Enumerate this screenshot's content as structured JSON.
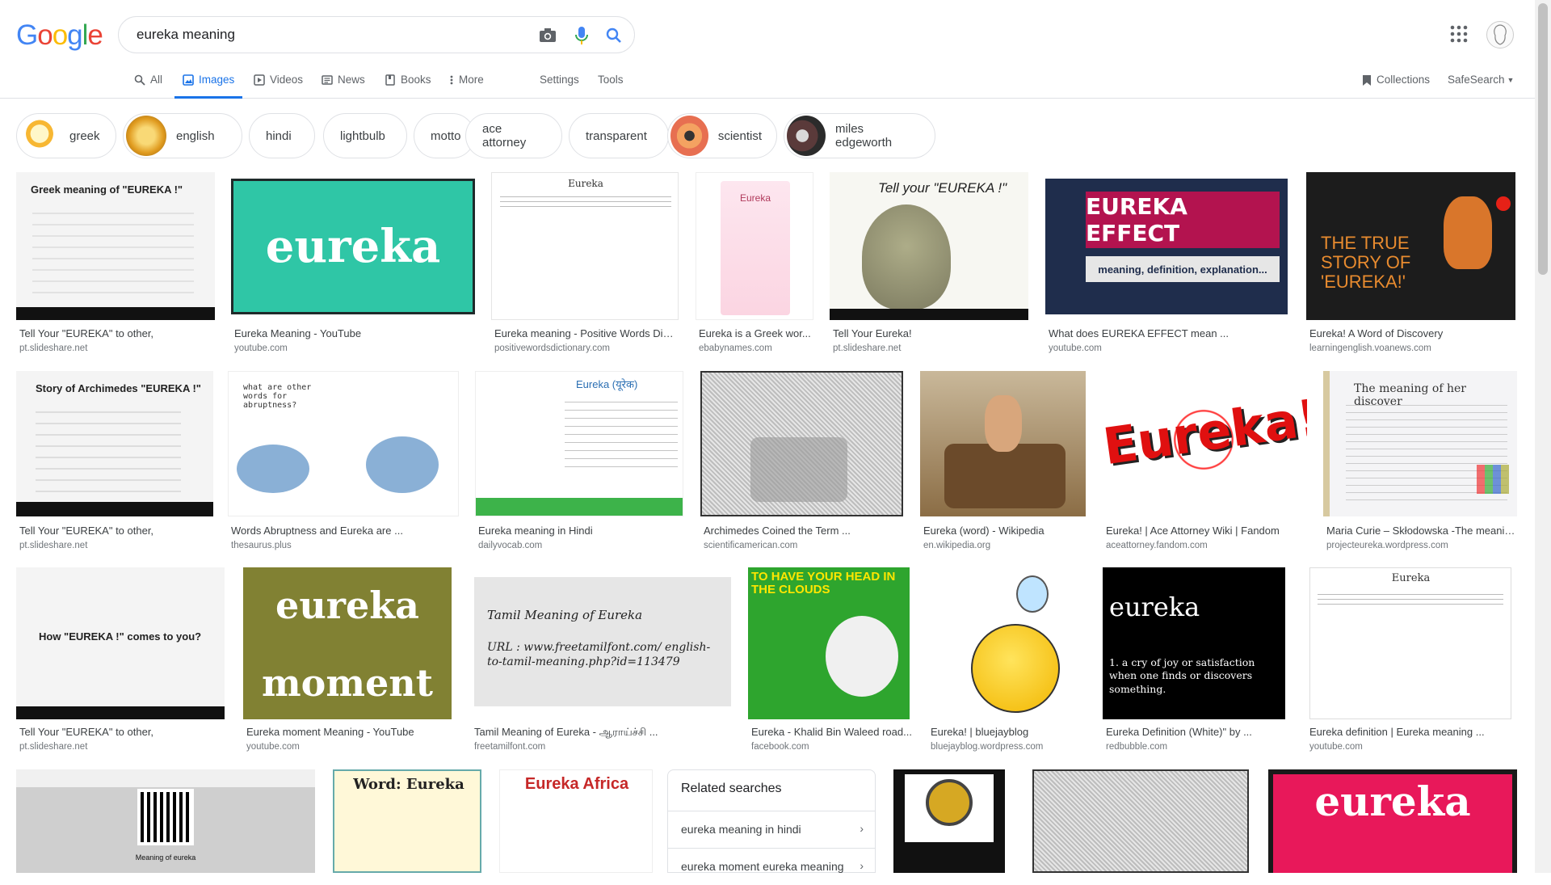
{
  "logo": {
    "letters": [
      "G",
      "o",
      "o",
      "g",
      "l",
      "e"
    ],
    "colors": [
      "#4285F4",
      "#EA4335",
      "#FBBC05",
      "#4285F4",
      "#34A853",
      "#EA4335"
    ]
  },
  "search": {
    "query": "eureka meaning",
    "placeholder": ""
  },
  "nav": {
    "tabs": [
      {
        "label": "All",
        "icon": "search-icon"
      },
      {
        "label": "Images",
        "icon": "image-icon",
        "active": true
      },
      {
        "label": "Videos",
        "icon": "play-icon"
      },
      {
        "label": "News",
        "icon": "news-icon"
      },
      {
        "label": "Books",
        "icon": "book-icon"
      },
      {
        "label": "More",
        "icon": "more-vert-icon"
      }
    ],
    "settings": "Settings",
    "tools": "Tools",
    "collections": "Collections",
    "safesearch": "SafeSearch"
  },
  "chips": [
    "greek",
    "english",
    "hindi",
    "lightbulb",
    "motto",
    "ace attorney",
    "transparent",
    "scientist",
    "miles edgeworth"
  ],
  "results": {
    "row1": [
      {
        "title": "Tell Your \"EUREKA\" to other,",
        "domain": "pt.slideshare.net",
        "caption": "Greek meaning of \"EUREKA !\""
      },
      {
        "title": "Eureka Meaning - YouTube",
        "domain": "youtube.com",
        "caption": "eureka"
      },
      {
        "title": "Eureka meaning - Positive Words Dicti...",
        "domain": "positivewordsdictionary.com",
        "caption": "Eureka"
      },
      {
        "title": "Eureka is a Greek wor...",
        "domain": "ebabynames.com",
        "caption": "Eureka"
      },
      {
        "title": "Tell Your Eureka!",
        "domain": "pt.slideshare.net",
        "caption": "Tell your \"EUREKA !\""
      },
      {
        "title": "What does EUREKA EFFECT mean ...",
        "domain": "youtube.com",
        "caption": "EUREKA EFFECT",
        "sub": "meaning, definition, explanation..."
      },
      {
        "title": "Eureka! A Word of Discovery",
        "domain": "learningenglish.voanews.com",
        "caption": "THE TRUE STORY OF 'EUREKA!'"
      }
    ],
    "row2": [
      {
        "title": "Tell Your \"EUREKA\" to other,",
        "domain": "pt.slideshare.net",
        "caption": "Story of Archimedes \"EUREKA !\""
      },
      {
        "title": "Words Abruptness and Eureka are ...",
        "domain": "thesaurus.plus",
        "caption": "what are other words for abruptness?"
      },
      {
        "title": "Eureka meaning in Hindi",
        "domain": "dailyvocab.com",
        "caption": "Eureka (यूरेक)"
      },
      {
        "title": "Archimedes Coined the Term ...",
        "domain": "scientificamerican.com",
        "caption": ""
      },
      {
        "title": "Eureka (word) - Wikipedia",
        "domain": "en.wikipedia.org",
        "caption": ""
      },
      {
        "title": "Eureka! | Ace Attorney Wiki | Fandom",
        "domain": "aceattorney.fandom.com",
        "caption": "Eureka!"
      },
      {
        "title": "Maria Curie – Skłodowska -The meanin...",
        "domain": "projecteureka.wordpress.com",
        "caption": "The meaning of her discover"
      }
    ],
    "row3": [
      {
        "title": "Tell Your \"EUREKA\" to other,",
        "domain": "pt.slideshare.net",
        "caption": "How \"EUREKA !\" comes to you?"
      },
      {
        "title": "Eureka moment Meaning - YouTube",
        "domain": "youtube.com",
        "caption": "eureka",
        "sub": "moment"
      },
      {
        "title": "Tamil Meaning of Eureka - ஆராய்ச்சி ...",
        "domain": "freetamilfont.com",
        "caption": "Tamil Meaning of Eureka",
        "sub": "URL : www.freetamilfont.com/ english-to-tamil-meaning.php?id=113479"
      },
      {
        "title": "Eureka - Khalid Bin Waleed road...",
        "domain": "facebook.com",
        "caption": "TO HAVE YOUR HEAD IN THE CLOUDS"
      },
      {
        "title": "Eureka! | bluejayblog",
        "domain": "bluejayblog.wordpress.com",
        "caption": ""
      },
      {
        "title": "Eureka Definition (White)\" by ...",
        "domain": "redbubble.com",
        "caption": "eureka",
        "sub": "1. a cry of joy or satisfaction when one finds or discovers something."
      },
      {
        "title": "Eureka definition | Eureka meaning ...",
        "domain": "youtube.com",
        "caption": "Eureka"
      }
    ],
    "row4": [
      {
        "caption": "Meaning of eureka"
      },
      {
        "caption": "Word: Eureka"
      },
      {
        "caption": "Eureka Africa"
      },
      {
        "caption": ""
      },
      {
        "caption": ""
      },
      {
        "caption": "eureka"
      }
    ]
  },
  "related": {
    "title": "Related searches",
    "items": [
      "eureka meaning in hindi",
      "eureka moment eureka meaning"
    ]
  }
}
